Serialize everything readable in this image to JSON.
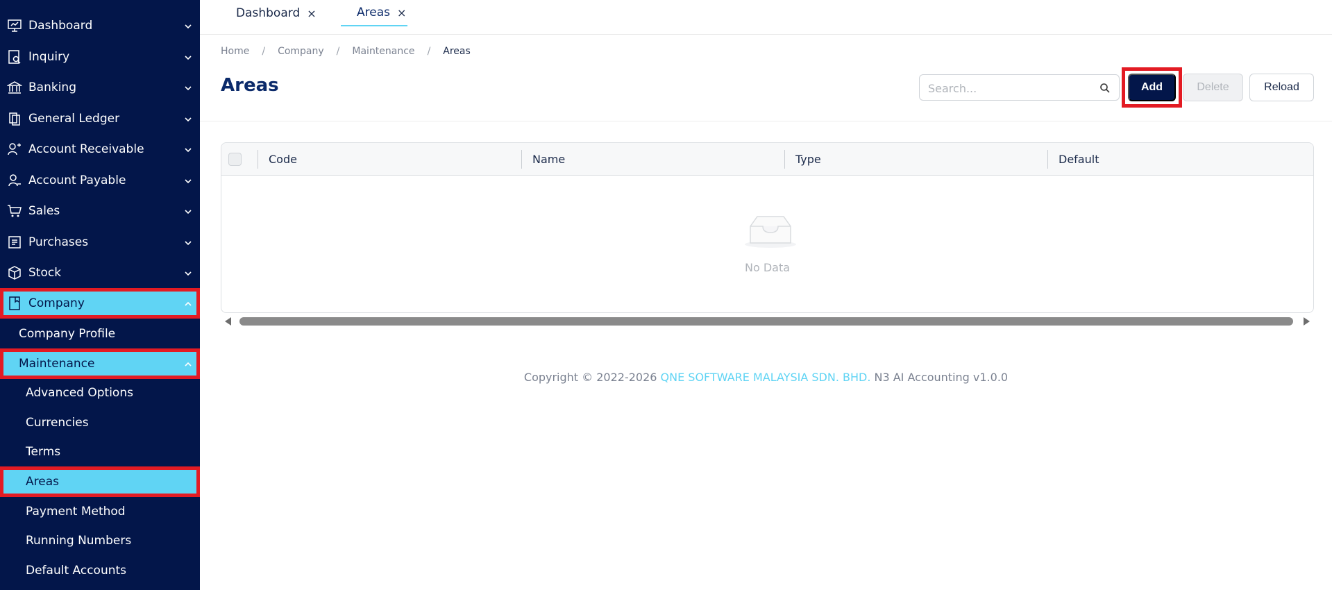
{
  "sidebar": {
    "items": [
      {
        "label": "Dashboard",
        "icon": "dashboard-icon"
      },
      {
        "label": "Inquiry",
        "icon": "inquiry-icon"
      },
      {
        "label": "Banking",
        "icon": "bank-icon"
      },
      {
        "label": "General Ledger",
        "icon": "ledger-icon"
      },
      {
        "label": "Account Receivable",
        "icon": "receivable-icon"
      },
      {
        "label": "Account Payable",
        "icon": "payable-icon"
      },
      {
        "label": "Sales",
        "icon": "cart-icon"
      },
      {
        "label": "Purchases",
        "icon": "purchases-icon"
      },
      {
        "label": "Stock",
        "icon": "box-icon"
      },
      {
        "label": "Company",
        "icon": "company-icon"
      }
    ],
    "company_sub": [
      {
        "label": "Company Profile"
      },
      {
        "label": "Maintenance"
      }
    ],
    "maintenance_sub": [
      {
        "label": "Advanced Options"
      },
      {
        "label": "Currencies"
      },
      {
        "label": "Terms"
      },
      {
        "label": "Areas"
      },
      {
        "label": "Payment Method"
      },
      {
        "label": "Running Numbers"
      },
      {
        "label": "Default Accounts"
      }
    ]
  },
  "tabs": [
    {
      "label": "Dashboard",
      "close": "×"
    },
    {
      "label": "Areas",
      "close": "×"
    }
  ],
  "breadcrumb": {
    "items": [
      "Home",
      "Company",
      "Maintenance",
      "Areas"
    ],
    "separator": "/"
  },
  "page": {
    "title": "Areas"
  },
  "toolbar": {
    "search_placeholder": "Search...",
    "add_label": "Add",
    "delete_label": "Delete",
    "reload_label": "Reload"
  },
  "table": {
    "columns": [
      "Code",
      "Name",
      "Type",
      "Default"
    ],
    "empty_text": "No Data"
  },
  "footer": {
    "prefix": "Copyright © 2022-2026 ",
    "company": "QNE SOFTWARE MALAYSIA SDN. BHD.",
    "suffix": " N3 AI Accounting v1.0.0"
  },
  "colors": {
    "sidebar_bg": "#03164a",
    "accent": "#60d4f4",
    "highlight_border": "#e31b23",
    "title": "#0b2a6a"
  }
}
